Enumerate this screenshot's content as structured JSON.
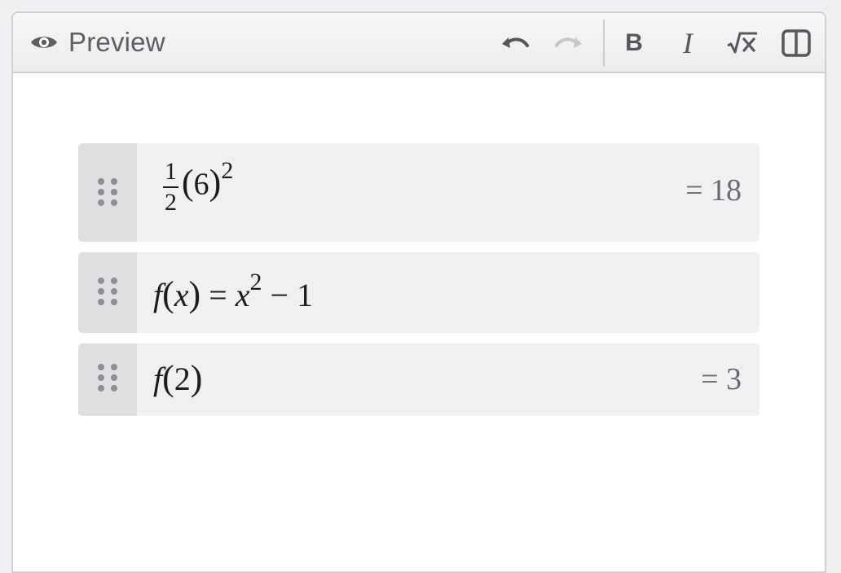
{
  "toolbar": {
    "preview_label": "Preview",
    "icons": {
      "preview": "eye-icon",
      "undo": "undo-icon",
      "redo": "redo-icon",
      "bold": "bold-icon",
      "italic": "italic-icon",
      "math": "square-root-icon",
      "split": "split-view-icon"
    },
    "bold_label": "B",
    "italic_label": "I",
    "math_label": "√x"
  },
  "expressions": [
    {
      "frac_num": "1",
      "frac_den": "2",
      "paren_open": "(",
      "base": "6",
      "paren_close": ")",
      "exp": "2",
      "result": "= 18"
    },
    {
      "fn": "f",
      "paren_open": "(",
      "arg": "x",
      "paren_close": ")",
      "eq": " = ",
      "var": "x",
      "exp": "2",
      "rest": " − 1",
      "result": ""
    },
    {
      "fn": "f",
      "paren_open": "(",
      "arg": "2",
      "paren_close": ")",
      "result": "= 3"
    }
  ],
  "colors": {
    "row_bg": "#eff0f2",
    "handle_bg": "#dedfe1",
    "toolbar_icon": "#626468",
    "redo_disabled": "#c6c7ca"
  }
}
